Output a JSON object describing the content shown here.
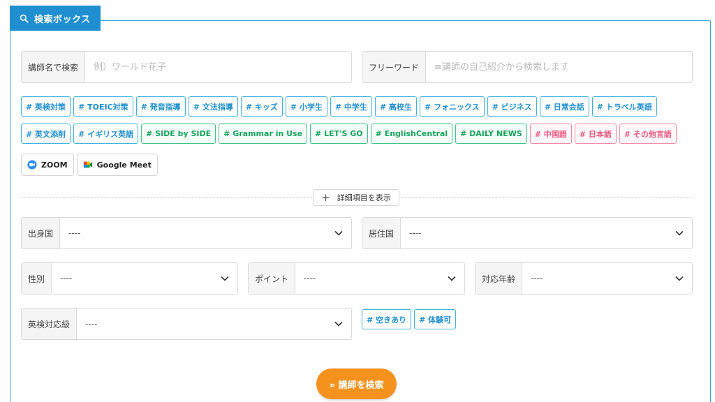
{
  "panel": {
    "title": "検索ボックス"
  },
  "teacher_name": {
    "label": "講師名で検索",
    "placeholder": "例）ワールド花子"
  },
  "free_word": {
    "label": "フリーワード",
    "placeholder": "≡講師の自己紹介から検索します"
  },
  "tags_row1": [
    {
      "label": "# 英検対策",
      "kind": "blue"
    },
    {
      "label": "# TOEIC対策",
      "kind": "blue"
    },
    {
      "label": "# 発音指導",
      "kind": "blue"
    },
    {
      "label": "# 文法指導",
      "kind": "blue"
    },
    {
      "label": "# キッズ",
      "kind": "blue"
    },
    {
      "label": "# 小学生",
      "kind": "blue"
    },
    {
      "label": "# 中学生",
      "kind": "blue"
    },
    {
      "label": "# 高校生",
      "kind": "blue"
    },
    {
      "label": "# フォニックス",
      "kind": "blue"
    },
    {
      "label": "# ビジネス",
      "kind": "blue"
    },
    {
      "label": "# 日常会話",
      "kind": "blue"
    },
    {
      "label": "# トラベル英語",
      "kind": "blue"
    }
  ],
  "tags_row2": [
    {
      "label": "# 英文添削",
      "kind": "blue"
    },
    {
      "label": "# イギリス英語",
      "kind": "blue"
    },
    {
      "label": "# SIDE by SIDE",
      "kind": "green"
    },
    {
      "label": "# Grammar in Use",
      "kind": "green"
    },
    {
      "label": "# LET'S GO",
      "kind": "green"
    },
    {
      "label": "# EnglishCentral",
      "kind": "green"
    },
    {
      "label": "# DAILY NEWS",
      "kind": "green"
    },
    {
      "label": "# 中国語",
      "kind": "pink"
    },
    {
      "label": "# 日本語",
      "kind": "pink"
    },
    {
      "label": "# その他言語",
      "kind": "pink"
    }
  ],
  "tools": {
    "zoom": "ZOOM",
    "meet": "Google Meet"
  },
  "expand": {
    "label": "詳細項目を表示"
  },
  "selects": {
    "birth_country": {
      "label": "出身国",
      "value": "----"
    },
    "residence": {
      "label": "居住国",
      "value": "----"
    },
    "gender": {
      "label": "性別",
      "value": "----"
    },
    "points": {
      "label": "ポイント",
      "value": "----"
    },
    "age": {
      "label": "対応年齢",
      "value": "----"
    },
    "eiken": {
      "label": "英検対応級",
      "value": "----"
    }
  },
  "tags_extra": [
    {
      "label": "# 空きあり",
      "kind": "blue"
    },
    {
      "label": "# 体験可",
      "kind": "blue"
    }
  ],
  "submit": {
    "label": "» 講師を検索"
  },
  "colors": {
    "accent": "#1f8fd1",
    "border": "#3ba7d9",
    "submit": "#f5921e",
    "green": "#17a35c",
    "pink": "#e8577e"
  }
}
